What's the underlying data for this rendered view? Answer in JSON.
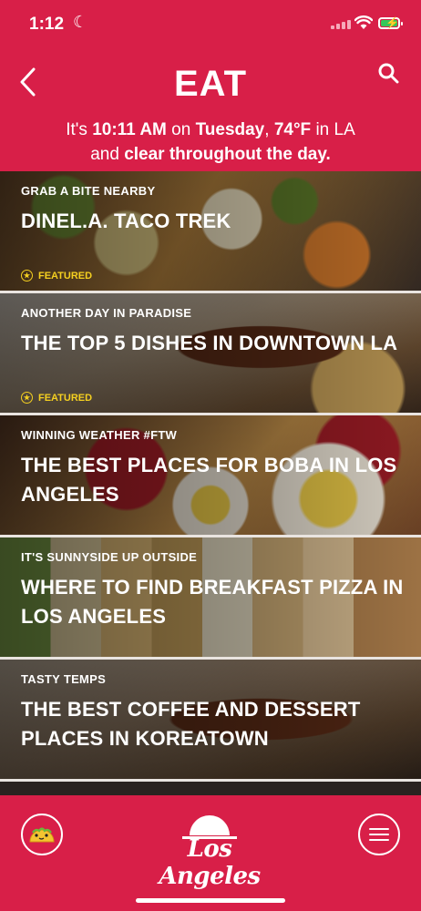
{
  "status": {
    "time": "1:12"
  },
  "header": {
    "title": "EAT",
    "subtitle": {
      "p1": "It's ",
      "time": "10:11 AM",
      "p2": " on ",
      "day": "Tuesday",
      "p3": ", ",
      "temp": "74°F",
      "p4": " in LA",
      "p5": "and ",
      "weather": "clear throughout the day."
    }
  },
  "cards": [
    {
      "kicker": "GRAB A BITE NEARBY",
      "headline": "DINEL.A. TACO TREK",
      "featured": "FEATURED"
    },
    {
      "kicker": "ANOTHER DAY IN PARADISE",
      "headline": "THE TOP 5 DISHES IN DOWNTOWN LA",
      "featured": "FEATURED"
    },
    {
      "kicker": "WINNING WEATHER #FTW",
      "headline": "THE BEST PLACES FOR BOBA IN LOS ANGELES"
    },
    {
      "kicker": "IT'S SUNNYSIDE UP OUTSIDE",
      "headline": "WHERE TO FIND BREAKFAST PIZZA IN LOS ANGELES"
    },
    {
      "kicker": "TASTY TEMPS",
      "headline": "THE BEST COFFEE AND DESSERT PLACES IN KOREATOWN"
    }
  ],
  "footer": {
    "logo": "Los Angeles"
  },
  "colors": {
    "brand": "#d81f48",
    "featured": "#f5d020"
  },
  "icons": {
    "back": "chevron-left-icon",
    "search": "search-icon",
    "taco": "taco-icon",
    "menu": "hamburger-menu-icon"
  }
}
